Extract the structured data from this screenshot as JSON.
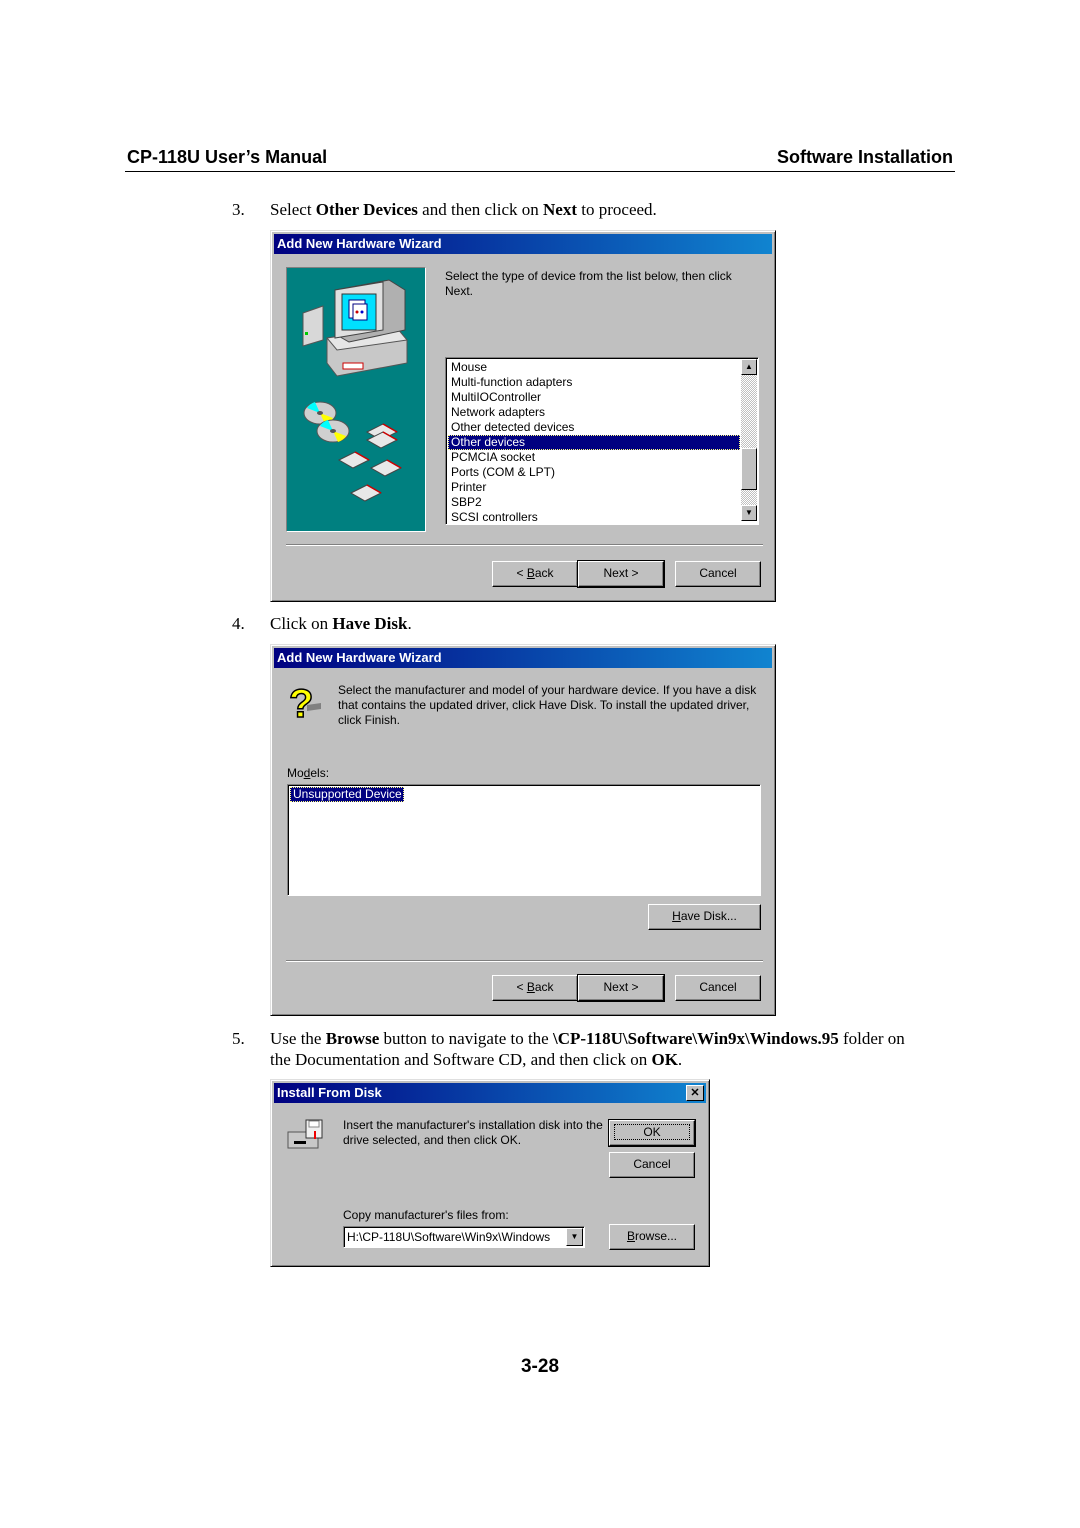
{
  "header": {
    "left": "CP-118U User’s Manual",
    "right": "Software Installation"
  },
  "steps": [
    {
      "num": "3.",
      "parts": [
        "Select ",
        "Other Devices",
        " and then click on ",
        "Next",
        " to proceed."
      ]
    },
    {
      "num": "4.",
      "parts": [
        "Click on ",
        "Have Disk",
        "."
      ]
    },
    {
      "num": "5.",
      "parts": [
        "Use the ",
        "Browse",
        " button to navigate to the ",
        "\\CP-118U\\Software\\Win9x\\Windows.95",
        " folder on"
      ],
      "line2": [
        "the Documentation and Software CD, and then click on ",
        "OK",
        "."
      ]
    }
  ],
  "dialog1": {
    "title": "Add New Hardware Wizard",
    "instruction": "Select the type of device from the list below, then click Next.",
    "list_items": [
      "Mouse",
      "Multi-function adapters",
      "MultiIOController",
      "Network adapters",
      "Other detected devices",
      "Other devices",
      "PCMCIA socket",
      "Ports (COM & LPT)",
      "Printer",
      "SBP2",
      "SCSI controllers"
    ],
    "selected_index": 5,
    "buttons": {
      "back_prefix": "< ",
      "back_key": "B",
      "back_rest": "ack",
      "next": "Next >",
      "cancel": "Cancel"
    }
  },
  "dialog2": {
    "title": "Add New Hardware Wizard",
    "instruction": "Select the manufacturer and model of your hardware device. If you have a disk that contains the updated driver, click Have Disk. To install the updated driver, click Finish.",
    "models_label_pre": "Mo",
    "models_label_key": "d",
    "models_label_post": "els:",
    "models": [
      "Unsupported Device"
    ],
    "have_disk_key": "H",
    "have_disk_rest": "ave Disk...",
    "buttons": {
      "back_prefix": "< ",
      "back_key": "B",
      "back_rest": "ack",
      "next": "Next >",
      "cancel": "Cancel"
    }
  },
  "dialog3": {
    "title": "Install From Disk",
    "close": "✕",
    "instruction": "Insert the manufacturer's installation disk into the drive selected, and then click OK.",
    "ok": "OK",
    "cancel": "Cancel",
    "copy_label": "Copy manufacturer's files from:",
    "path_value": "H:\\CP-118U\\Software\\Win9x\\Windows",
    "browse_key": "B",
    "browse_rest": "rowse..."
  },
  "page_number": "3-28"
}
